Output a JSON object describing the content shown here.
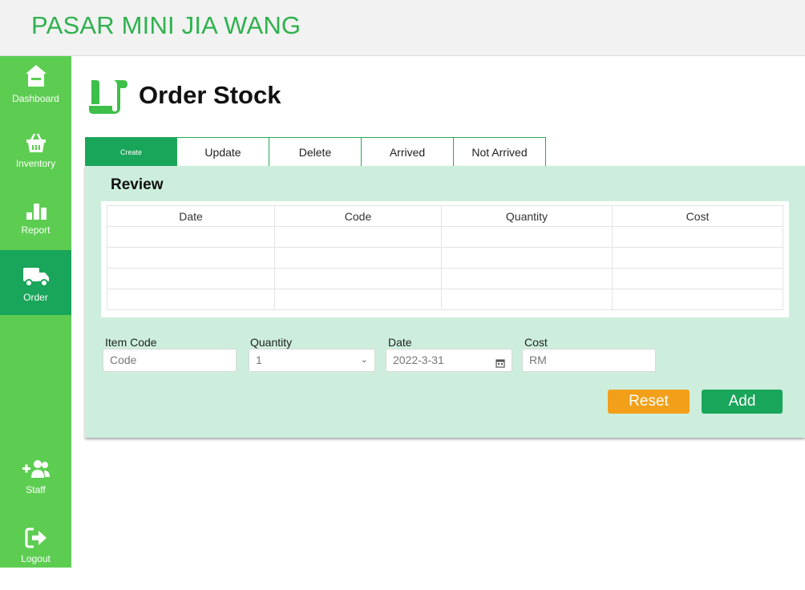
{
  "app": {
    "title": "PASAR MINI JIA WANG"
  },
  "sidebar": {
    "items": [
      {
        "label": "Dashboard",
        "icon": "home-icon"
      },
      {
        "label": "Inventory",
        "icon": "basket-icon"
      },
      {
        "label": "Report",
        "icon": "bar-chart-icon"
      },
      {
        "label": "Order",
        "icon": "truck-icon",
        "active": true
      },
      {
        "label": "Staff",
        "icon": "add-users-icon"
      },
      {
        "label": "Logout",
        "icon": "logout-icon"
      }
    ]
  },
  "page": {
    "title": "Order Stock",
    "icon": "scroll-icon"
  },
  "tabs": [
    {
      "label": "Create",
      "active": true
    },
    {
      "label": "Update"
    },
    {
      "label": "Delete"
    },
    {
      "label": "Arrived"
    },
    {
      "label": "Not Arrived"
    }
  ],
  "review": {
    "title": "Review",
    "columns": [
      "Date",
      "Code",
      "Quantity",
      "Cost"
    ],
    "rows": [
      [
        "",
        "",
        "",
        ""
      ],
      [
        "",
        "",
        "",
        ""
      ],
      [
        "",
        "",
        "",
        ""
      ],
      [
        "",
        "",
        "",
        ""
      ]
    ]
  },
  "form": {
    "item_code": {
      "label": "Item Code",
      "placeholder": "Code"
    },
    "quantity": {
      "label": "Quantity",
      "value": "1"
    },
    "date": {
      "label": "Date",
      "value": "2022-3-31"
    },
    "cost": {
      "label": "Cost",
      "placeholder": "RM"
    }
  },
  "buttons": {
    "reset": "Reset",
    "add": "Add"
  },
  "colors": {
    "sidebar": "#5dcd52",
    "accent": "#19a55a",
    "title_green": "#2fb14e",
    "panel": "#cdeedc",
    "reset": "#f2a019"
  }
}
